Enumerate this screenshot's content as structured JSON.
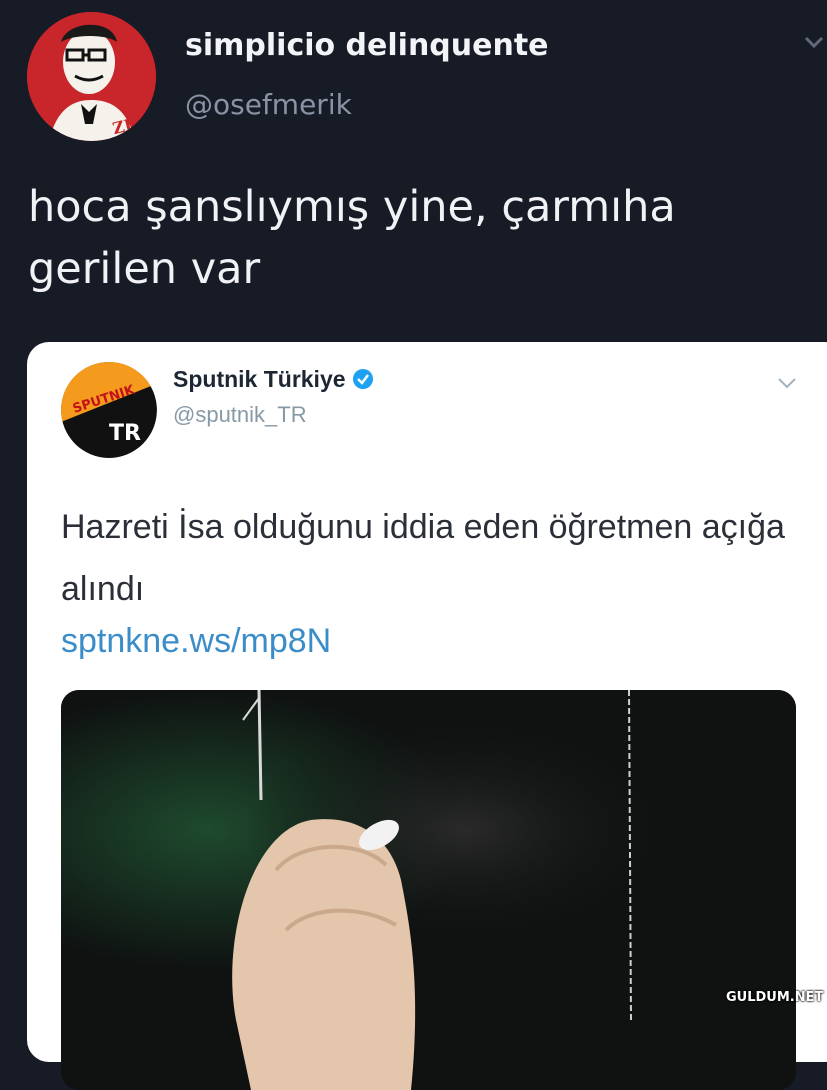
{
  "outer_tweet": {
    "display_name": "simplicio delinquente",
    "handle": "@osefmerik",
    "text": "hoca şanslıymış yine, çarmıha gerilen var",
    "avatar_text": "ZBH"
  },
  "quoted_tweet": {
    "display_name": "Sputnik Türkiye",
    "handle": "@sputnik_TR",
    "text": "Hazreti İsa olduğunu iddia eden öğretmen açığa alındı",
    "link": "sptnkne.ws/mp8N",
    "avatar_logo_text": "SPUTNIK",
    "avatar_badge_text": "TR"
  },
  "watermark": "GULDUM.NET",
  "colors": {
    "background": "#161b26",
    "link": "#3b8dc9",
    "verified": "#1da1f2"
  }
}
